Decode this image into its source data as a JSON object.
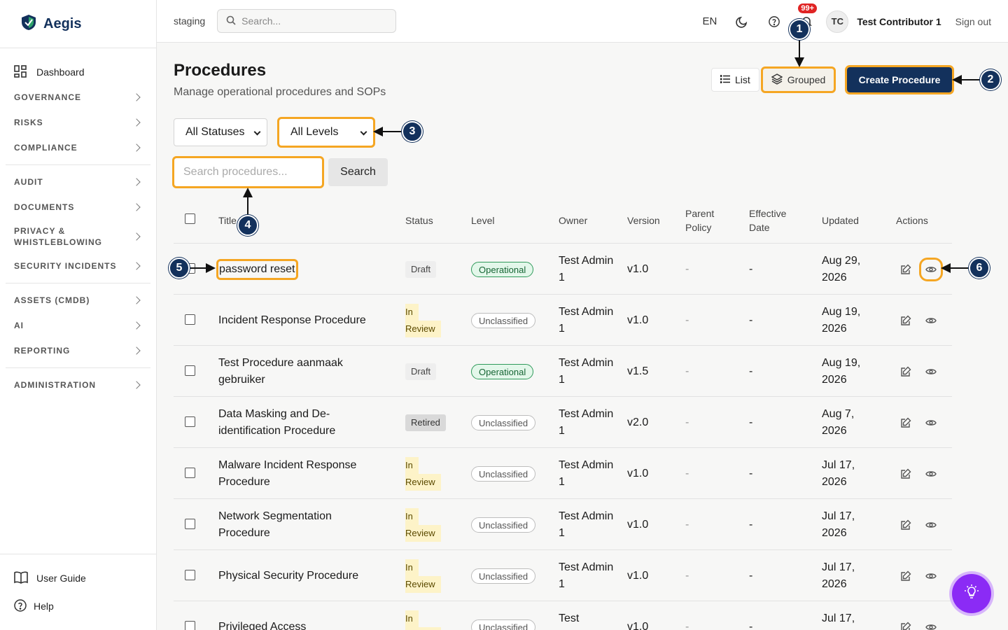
{
  "brand": {
    "name": "Aegis"
  },
  "sidebar": {
    "dashboard": "Dashboard",
    "groups": [
      [
        "GOVERNANCE",
        "RISKS",
        "COMPLIANCE"
      ],
      [
        "AUDIT",
        "DOCUMENTS",
        "PRIVACY & WHISTLEBLOWING",
        "SECURITY INCIDENTS"
      ],
      [
        "ASSETS (CMDB)",
        "AI",
        "REPORTING"
      ],
      [
        "ADMINISTRATION"
      ]
    ],
    "footer": {
      "guide": "User Guide",
      "help": "Help"
    }
  },
  "header": {
    "env": "staging",
    "search_placeholder": "Search...",
    "lang": "EN",
    "notifications": "99+",
    "avatar": "TC",
    "user": "Test Contributor 1",
    "signout": "Sign out"
  },
  "page": {
    "title": "Procedures",
    "subtitle": "Manage operational procedures and SOPs",
    "view_list": "List",
    "view_grouped": "Grouped",
    "create": "Create Procedure",
    "filter_status": "All Statuses",
    "filter_level": "All Levels",
    "search_placeholder": "Search procedures...",
    "search_button": "Search"
  },
  "table": {
    "headers": {
      "title": "Title",
      "status": "Status",
      "level": "Level",
      "owner": "Owner",
      "version": "Version",
      "parent": "Parent Policy",
      "effective": "Effective Date",
      "updated": "Updated",
      "actions": "Actions"
    },
    "rows": [
      {
        "title": "password reset",
        "status": "Draft",
        "level": "Operational",
        "owner": "Test Admin 1",
        "version": "v1.0",
        "parent": "-",
        "effective": "-",
        "updated": "Aug 29, 2026"
      },
      {
        "title": "Incident Response Procedure",
        "status": "In Review",
        "level": "Unclassified",
        "owner": "Test Admin 1",
        "version": "v1.0",
        "parent": "-",
        "effective": "-",
        "updated": "Aug 19, 2026"
      },
      {
        "title": "Test Procedure aanmaak gebruiker",
        "status": "Draft",
        "level": "Operational",
        "owner": "Test Admin 1",
        "version": "v1.5",
        "parent": "-",
        "effective": "-",
        "updated": "Aug 19, 2026"
      },
      {
        "title": "Data Masking and De-identification Procedure",
        "status": "Retired",
        "level": "Unclassified",
        "owner": "Test Admin 1",
        "version": "v2.0",
        "parent": "-",
        "effective": "-",
        "updated": "Aug 7, 2026"
      },
      {
        "title": "Malware Incident Response Procedure",
        "status": "In Review",
        "level": "Unclassified",
        "owner": "Test Admin 1",
        "version": "v1.0",
        "parent": "-",
        "effective": "-",
        "updated": "Jul 17, 2026"
      },
      {
        "title": "Network Segmentation Procedure",
        "status": "In Review",
        "level": "Unclassified",
        "owner": "Test Admin 1",
        "version": "v1.0",
        "parent": "-",
        "effective": "-",
        "updated": "Jul 17, 2026"
      },
      {
        "title": "Physical Security Procedure",
        "status": "In Review",
        "level": "Unclassified",
        "owner": "Test Admin 1",
        "version": "v1.0",
        "parent": "-",
        "effective": "-",
        "updated": "Jul 17, 2026"
      },
      {
        "title": "Privileged Access",
        "status": "In Review",
        "level": "Unclassified",
        "owner": "Test",
        "version": "v1.0",
        "parent": "-",
        "effective": "-",
        "updated": "Jul 17,"
      }
    ]
  },
  "callouts": [
    "1",
    "2",
    "3",
    "4",
    "5",
    "6"
  ],
  "colors": {
    "brand": "#13315c",
    "highlight": "#f5a623",
    "fab": "#8b2bf5"
  }
}
